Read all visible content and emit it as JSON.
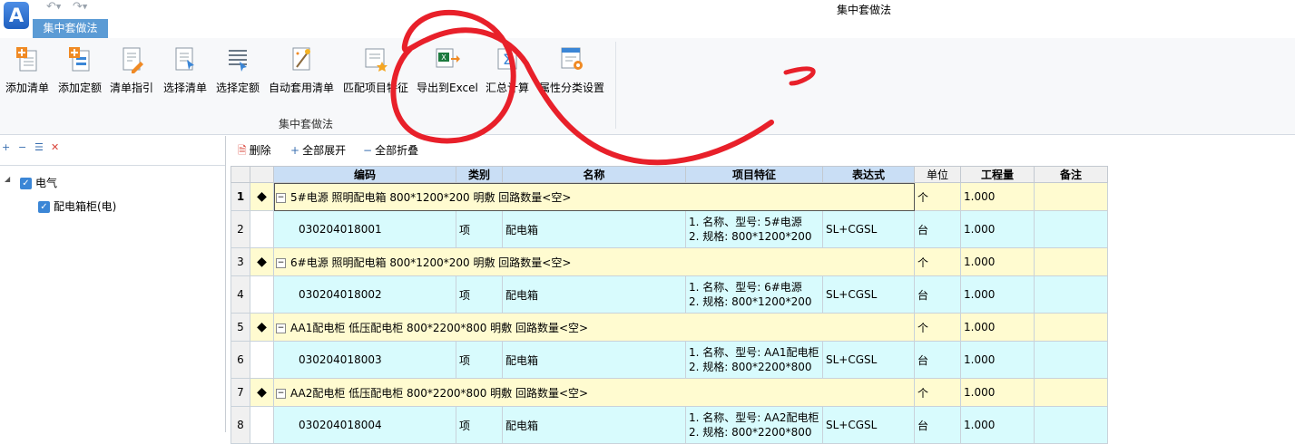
{
  "app": {
    "logo_letter": "A",
    "window_title": "集中套做法"
  },
  "ribbon": {
    "tab_label": "集中套做法",
    "group_label": "集中套做法",
    "buttons": [
      {
        "label": "添加清单",
        "icon": "add-bill-icon"
      },
      {
        "label": "添加定额",
        "icon": "add-quota-icon"
      },
      {
        "label": "清单指引",
        "icon": "bill-guide-icon"
      },
      {
        "label": "选择清单",
        "icon": "select-bill-icon"
      },
      {
        "label": "选择定额",
        "icon": "select-quota-icon"
      },
      {
        "label": "自动套用清单",
        "icon": "auto-apply-icon"
      },
      {
        "label": "匹配项目特征",
        "icon": "match-feature-icon"
      },
      {
        "label": "导出到Excel",
        "icon": "excel-export-icon"
      },
      {
        "label": "汇总计算",
        "icon": "sum-calc-icon"
      },
      {
        "label": "属性分类设置",
        "icon": "property-settings-icon"
      }
    ]
  },
  "tree": {
    "root_label": "电气",
    "child_label": "配电箱柜(电)"
  },
  "toolbar": {
    "delete_label": "删除",
    "expand_label": "全部展开",
    "collapse_label": "全部折叠"
  },
  "grid": {
    "headers": {
      "code": "编码",
      "type": "类别",
      "name": "名称",
      "features": "项目特征",
      "expression": "表达式",
      "unit": "单位",
      "quantity": "工程量",
      "remark": "备注"
    },
    "rows": [
      {
        "num": "1",
        "kind": "group",
        "desc": "5#电源 照明配电箱 800*1200*200 明敷 回路数量<空>",
        "unit": "个",
        "quantity": "1.000"
      },
      {
        "num": "2",
        "kind": "item",
        "code": "030204018001",
        "type": "项",
        "name": "配电箱",
        "feat1": "1. 名称、型号: 5#电源",
        "feat2": "2. 规格: 800*1200*200",
        "expression": "SL+CGSL",
        "unit": "台",
        "quantity": "1.000"
      },
      {
        "num": "3",
        "kind": "group",
        "desc": "6#电源 照明配电箱 800*1200*200 明敷 回路数量<空>",
        "unit": "个",
        "quantity": "1.000"
      },
      {
        "num": "4",
        "kind": "item",
        "code": "030204018002",
        "type": "项",
        "name": "配电箱",
        "feat1": "1. 名称、型号: 6#电源",
        "feat2": "2. 规格: 800*1200*200",
        "expression": "SL+CGSL",
        "unit": "台",
        "quantity": "1.000"
      },
      {
        "num": "5",
        "kind": "group",
        "desc": "AA1配电柜 低压配电柜 800*2200*800 明敷 回路数量<空>",
        "unit": "个",
        "quantity": "1.000"
      },
      {
        "num": "6",
        "kind": "item",
        "code": "030204018003",
        "type": "项",
        "name": "配电箱",
        "feat1": "1. 名称、型号: AA1配电柜",
        "feat2": "2. 规格: 800*2200*800",
        "expression": "SL+CGSL",
        "unit": "台",
        "quantity": "1.000"
      },
      {
        "num": "7",
        "kind": "group",
        "desc": "AA2配电柜 低压配电柜 800*2200*800 明敷 回路数量<空>",
        "unit": "个",
        "quantity": "1.000"
      },
      {
        "num": "8",
        "kind": "item",
        "code": "030204018004",
        "type": "项",
        "name": "配电箱",
        "feat1": "1. 名称、型号: AA2配电柜",
        "feat2": "2. 规格: 800*2200*800",
        "expression": "SL+CGSL",
        "unit": "台",
        "quantity": "1.000"
      }
    ]
  },
  "colors": {
    "accent": "#5b9bd5",
    "group_row": "#fffbd0",
    "item_row": "#d8fbfd",
    "header": "#c9def5",
    "annotation": "#e8202a"
  }
}
